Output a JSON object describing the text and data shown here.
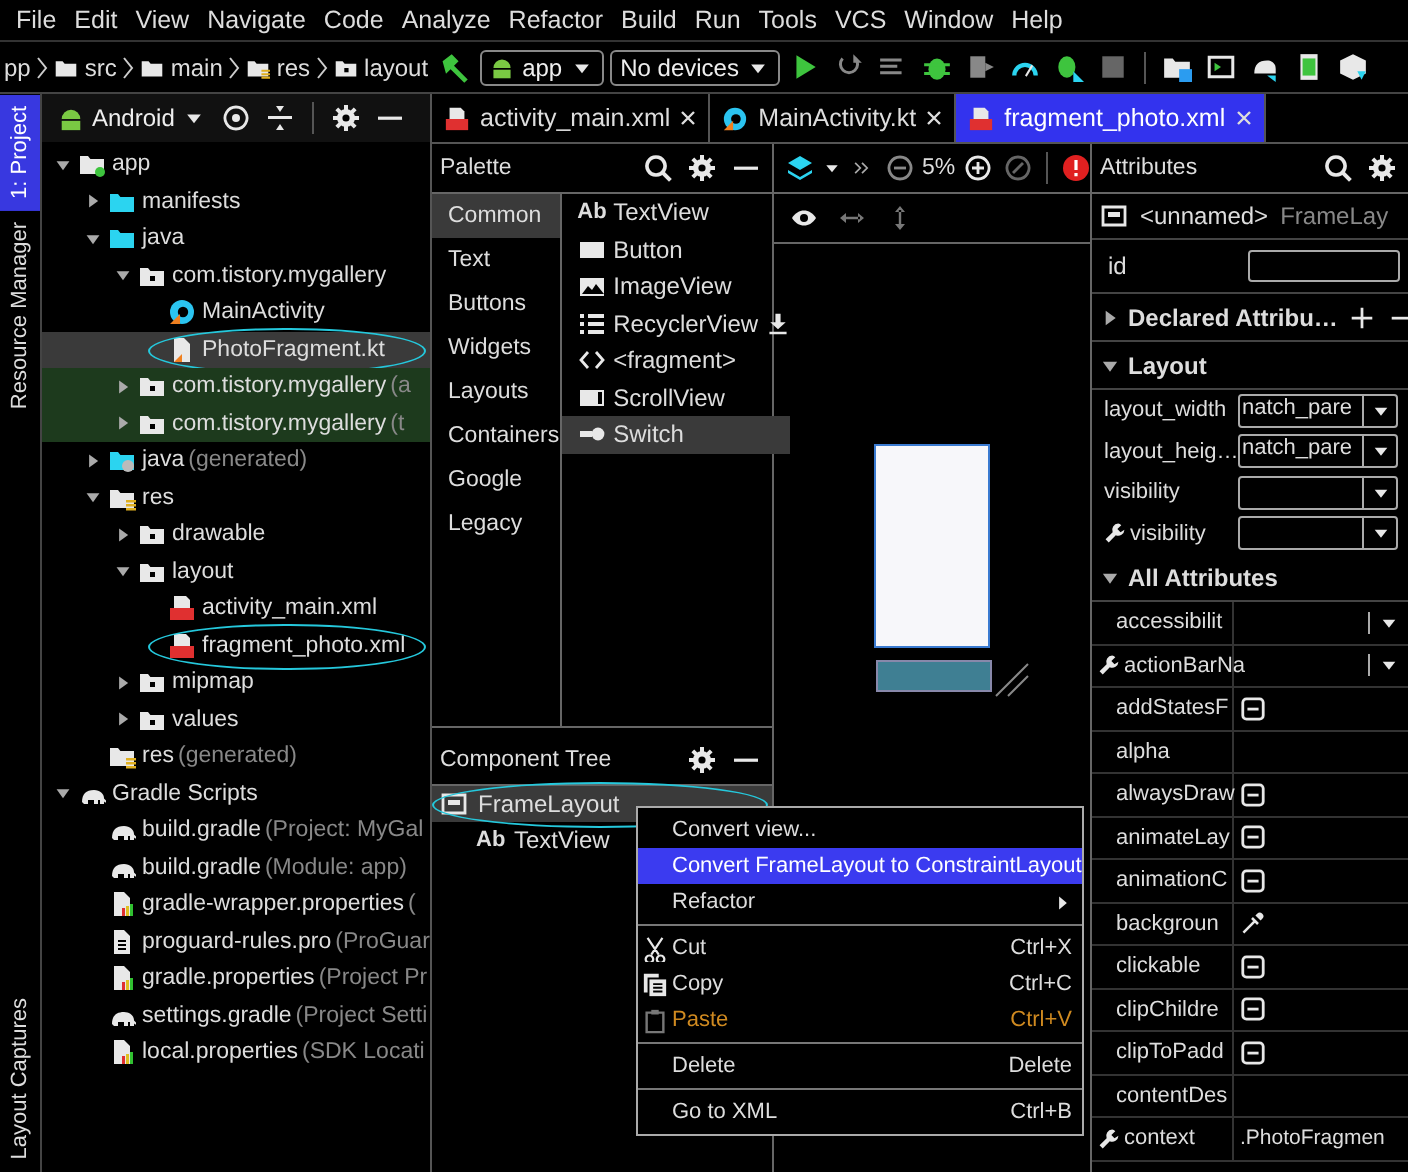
{
  "menu": [
    "File",
    "Edit",
    "View",
    "Navigate",
    "Code",
    "Analyze",
    "Refactor",
    "Build",
    "Run",
    "Tools",
    "VCS",
    "Window",
    "Help"
  ],
  "breadcrumb": [
    {
      "label": "pp",
      "kind": "none"
    },
    {
      "label": "src",
      "kind": "folder"
    },
    {
      "label": "main",
      "kind": "folder"
    },
    {
      "label": "res",
      "kind": "res"
    },
    {
      "label": "layout",
      "kind": "package"
    }
  ],
  "run_config": "app",
  "device": "No devices",
  "side_tabs": [
    {
      "label": "1: Project",
      "selected": true
    },
    {
      "label": "Resource Manager",
      "selected": false
    }
  ],
  "bottom_side_tabs": [
    {
      "label": "Layout Captures",
      "selected": false
    }
  ],
  "project": {
    "view": "Android",
    "tree": [
      {
        "label": "app",
        "kind": "module",
        "expanded": true,
        "selected": false,
        "test": false,
        "children": [
          {
            "label": "manifests",
            "kind": "folder-src",
            "expanded": false,
            "selected": false,
            "test": false
          },
          {
            "label": "java",
            "kind": "folder-src",
            "expanded": true,
            "selected": false,
            "test": false,
            "children": [
              {
                "label": "com.tistory.mygallery",
                "kind": "package",
                "expanded": true,
                "selected": false,
                "test": false,
                "children": [
                  {
                    "label": "MainActivity",
                    "kind": "kotlin-class",
                    "selected": false,
                    "test": false
                  },
                  {
                    "label": "PhotoFragment.kt",
                    "kind": "kotlin-file",
                    "selected": true,
                    "test": false,
                    "annotated": true
                  }
                ]
              },
              {
                "label": "com.tistory.mygallery",
                "note": "(a",
                "kind": "package",
                "expanded": false,
                "selected": false,
                "test": true
              },
              {
                "label": "com.tistory.mygallery",
                "note": "(t",
                "kind": "package",
                "expanded": false,
                "selected": false,
                "test": true
              }
            ]
          },
          {
            "label": "java",
            "note": "(generated)",
            "kind": "folder-gen",
            "expanded": false,
            "selected": false,
            "test": false
          },
          {
            "label": "res",
            "kind": "res",
            "expanded": true,
            "selected": false,
            "test": false,
            "children": [
              {
                "label": "drawable",
                "kind": "package",
                "expanded": false,
                "selected": false,
                "test": false
              },
              {
                "label": "layout",
                "kind": "package",
                "expanded": true,
                "selected": false,
                "test": false,
                "children": [
                  {
                    "label": "activity_main.xml",
                    "kind": "xml",
                    "selected": false,
                    "test": false
                  },
                  {
                    "label": "fragment_photo.xml",
                    "kind": "xml",
                    "selected": false,
                    "test": false,
                    "annotated": true
                  }
                ]
              },
              {
                "label": "mipmap",
                "kind": "package",
                "expanded": false,
                "selected": false,
                "test": false
              },
              {
                "label": "values",
                "kind": "package",
                "expanded": false,
                "selected": false,
                "test": false
              }
            ]
          },
          {
            "label": "res",
            "note": "(generated)",
            "kind": "res",
            "selected": false,
            "test": false
          }
        ]
      },
      {
        "label": "Gradle Scripts",
        "kind": "gradle",
        "expanded": true,
        "selected": false,
        "test": false,
        "children": [
          {
            "label": "build.gradle",
            "note": "(Project: MyGal",
            "kind": "gradle",
            "selected": false,
            "test": false
          },
          {
            "label": "build.gradle",
            "note": "(Module: app)",
            "kind": "gradle",
            "selected": false,
            "test": false
          },
          {
            "label": "gradle-wrapper.properties",
            "note": "(",
            "kind": "props",
            "selected": false,
            "test": false
          },
          {
            "label": "proguard-rules.pro",
            "note": "(ProGuar",
            "kind": "file",
            "selected": false,
            "test": false
          },
          {
            "label": "gradle.properties",
            "note": "(Project Pr",
            "kind": "props",
            "selected": false,
            "test": false
          },
          {
            "label": "settings.gradle",
            "note": "(Project Setti",
            "kind": "gradle",
            "selected": false,
            "test": false
          },
          {
            "label": "local.properties",
            "note": "(SDK Locati",
            "kind": "props",
            "selected": false,
            "test": false
          }
        ]
      }
    ]
  },
  "editor_tabs": [
    {
      "label": "activity_main.xml",
      "kind": "xml",
      "selected": false
    },
    {
      "label": "MainActivity.kt",
      "kind": "kotlin-class",
      "selected": false
    },
    {
      "label": "fragment_photo.xml",
      "kind": "xml",
      "selected": true
    }
  ],
  "palette": {
    "title": "Palette",
    "categories": [
      {
        "label": "Common",
        "selected": true
      },
      {
        "label": "Text",
        "selected": false
      },
      {
        "label": "Buttons",
        "selected": false
      },
      {
        "label": "Widgets",
        "selected": false
      },
      {
        "label": "Layouts",
        "selected": false
      },
      {
        "label": "Containers",
        "selected": false
      },
      {
        "label": "Google",
        "selected": false
      },
      {
        "label": "Legacy",
        "selected": false
      }
    ],
    "items": [
      {
        "label": "TextView",
        "kind": "text",
        "icon_text": "Ab",
        "selected": false
      },
      {
        "label": "Button",
        "kind": "button",
        "selected": false
      },
      {
        "label": "ImageView",
        "kind": "image",
        "selected": false
      },
      {
        "label": "RecyclerView",
        "kind": "list",
        "download": true,
        "selected": false
      },
      {
        "label": "<fragment>",
        "kind": "fragment",
        "selected": false
      },
      {
        "label": "ScrollView",
        "kind": "scroll",
        "selected": false
      },
      {
        "label": "Switch",
        "kind": "switch",
        "selected": true
      }
    ]
  },
  "design": {
    "zoom": "5%"
  },
  "component_tree": {
    "title": "Component Tree",
    "rows": [
      {
        "label": "FrameLayout",
        "kind": "layout",
        "selected": true,
        "annotated": true,
        "children": [
          {
            "label": "TextView",
            "kind": "text",
            "icon_text": "Ab",
            "selected": false
          }
        ]
      }
    ]
  },
  "context_menu": [
    {
      "kind": "item",
      "label": "Convert view...",
      "selected": false,
      "disabled": false
    },
    {
      "kind": "item",
      "label": "Convert FrameLayout to ConstraintLayout",
      "selected": true,
      "disabled": false
    },
    {
      "kind": "item",
      "label": "Refactor",
      "submenu": true,
      "selected": false,
      "disabled": false
    },
    {
      "kind": "separator"
    },
    {
      "kind": "cut",
      "label": "Cut",
      "shortcut": "Ctrl+X",
      "selected": false,
      "disabled": false
    },
    {
      "kind": "copy",
      "label": "Copy",
      "shortcut": "Ctrl+C",
      "selected": false,
      "disabled": false
    },
    {
      "kind": "paste",
      "label": "Paste",
      "shortcut": "Ctrl+V",
      "selected": false,
      "disabled": true
    },
    {
      "kind": "separator"
    },
    {
      "kind": "item",
      "label": "Delete",
      "shortcut": "Delete",
      "selected": false,
      "disabled": false
    },
    {
      "kind": "separator"
    },
    {
      "kind": "item",
      "label": "Go to XML",
      "shortcut": "Ctrl+B",
      "selected": false,
      "disabled": false
    }
  ],
  "attributes": {
    "title": "Attributes",
    "component": "<unnamed>",
    "component_type": "FrameLay",
    "id_label": "id",
    "sections": [
      {
        "title": "Declared Attribu…",
        "expanded": false,
        "add": true
      },
      {
        "title": "Layout",
        "expanded": true,
        "rows": [
          {
            "name": "layout_width",
            "value": "natch_pare",
            "kind": "dropdown",
            "tool": false
          },
          {
            "name": "layout_heig…",
            "value": "natch_pare",
            "kind": "dropdown",
            "tool": false
          },
          {
            "name": "visibility",
            "kind": "dropdown",
            "tool": false
          },
          {
            "name": "visibility",
            "kind": "dropdown",
            "tool": true
          }
        ]
      },
      {
        "title": "All Attributes",
        "expanded": true,
        "kind": "table",
        "rows": [
          {
            "name": "accessibilit",
            "kind": "dropdown",
            "tool": false
          },
          {
            "name": "actionBarNa",
            "kind": "dropdown",
            "tool": true
          },
          {
            "name": "addStatesF",
            "kind": "flag",
            "tool": false
          },
          {
            "name": "alpha",
            "kind": "empty",
            "tool": false
          },
          {
            "name": "alwaysDraw",
            "kind": "flag",
            "tool": false
          },
          {
            "name": "animateLay",
            "kind": "flag",
            "tool": false
          },
          {
            "name": "animationC",
            "kind": "flag",
            "tool": false
          },
          {
            "name": "backgroun",
            "kind": "color",
            "tool": false
          },
          {
            "name": "clickable",
            "kind": "flag",
            "tool": false
          },
          {
            "name": "clipChildre",
            "kind": "flag",
            "tool": false
          },
          {
            "name": "clipToPadd",
            "kind": "flag",
            "tool": false
          },
          {
            "name": "contentDes",
            "kind": "empty",
            "tool": false
          },
          {
            "name": "context",
            "value": ".PhotoFragmen",
            "kind": "text",
            "tool": true
          }
        ]
      }
    ]
  }
}
